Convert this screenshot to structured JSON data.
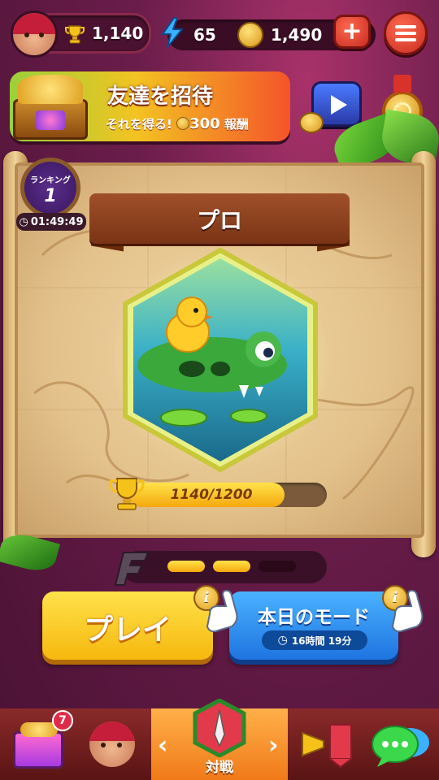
{
  "topbar": {
    "trophies": "1,140",
    "energy": "65",
    "coins": "1,490",
    "add_icon": "plus-icon",
    "menu_icon": "hamburger-icon"
  },
  "banner": {
    "title": "友達を招待",
    "subtitle_prefix": "それを得る!",
    "reward_amount": "300",
    "reward_label": "報酬"
  },
  "ranking": {
    "label": "ランキング",
    "value": "1",
    "timer": "01:49:49"
  },
  "league": {
    "title": "プロ",
    "progress_text": "1140/1200",
    "progress_fraction": 0.95
  },
  "steps": {
    "filled": 2,
    "total": 3
  },
  "actions": {
    "play_label": "プレイ",
    "mode_label": "本日のモード",
    "mode_timer": "16時間 19分",
    "info_glyph": "i"
  },
  "bottom_nav": {
    "shop_badge": "7",
    "battle_label": "対戦",
    "left_arrow": "‹",
    "right_arrow": "›"
  },
  "colors": {
    "background": "#6a1d4a",
    "play_button": "#f5b80e",
    "mode_button": "#1e74e0",
    "nav_selected": "#f07a18"
  }
}
